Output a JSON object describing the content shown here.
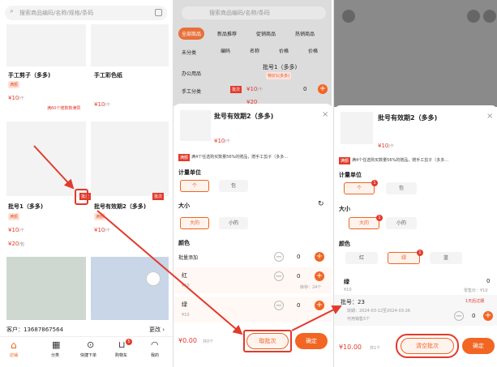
{
  "panel1": {
    "search_placeholder": "搜索商品编码/名称/规格/条码",
    "items": [
      {
        "name": "手工剪子（多多)",
        "tag": "满额",
        "price": "¥10",
        "unit": "/个",
        "promo": "满60个赠数数满赞"
      },
      {
        "name": "手工彩色纸",
        "price": "¥10",
        "unit": "/个"
      },
      {
        "name": "批号1（多多)",
        "tag": "满额",
        "price": "¥10",
        "unit": "/个",
        "price2": "¥20",
        "unit2": "/包",
        "pici": "批次"
      },
      {
        "name": "批号有效期2（多多)",
        "pici": "批次",
        "tag": "满额",
        "price": "¥10",
        "unit": "/个"
      }
    ],
    "customer": "客户：13687867564",
    "more": "更改 ›",
    "nav": [
      "店铺",
      "分类",
      "快捷下单",
      "购物车",
      "我的"
    ],
    "cart_count": "5"
  },
  "panel2": {
    "search_placeholder": "搜索商品编码/名称/条码",
    "cats": [
      "全部商品",
      "新品推荐",
      "促销商品",
      "热销商品"
    ],
    "cols": [
      "编码",
      "名称",
      "价格",
      "价格"
    ],
    "side": [
      "未分类",
      "办公用品",
      "手工分类"
    ],
    "list_name": "批号1（多多)",
    "list_tag": "特价1(多多)",
    "list_price": "¥10",
    "list_unit": "/个",
    "list_price2": "¥20",
    "list_zero": "0",
    "sheet": {
      "title": "批号有效期2（多多)",
      "price": "¥10",
      "unit": "/个",
      "promo_tag": "满额",
      "promo": "满4个任选购买数量56%的赠品，赠手工剪子（多多...",
      "label_unit": "计量单位",
      "units": [
        "个",
        "包"
      ],
      "label_size": "大小",
      "sizes": [
        "大的",
        "小的"
      ],
      "label_color": "颜色",
      "batch_add": "批量添加",
      "variants": [
        {
          "name": "红",
          "price": "¥10",
          "stock": "库存：24个",
          "qty": "0"
        },
        {
          "name": "绿",
          "price": "¥10",
          "qty": "0"
        }
      ],
      "batch_qty": "0",
      "total": "¥0.00",
      "count": "共0个",
      "btn_batch": "取批次",
      "btn_ok": "确定"
    }
  },
  "panel3": {
    "sheet": {
      "title": "批号有效期2（多多)",
      "price": "¥10",
      "unit": "/个",
      "promo_tag": "满额",
      "promo": "满4个任选购买数量56%的赠品，赠手工剪子（多多...",
      "label_unit": "计量单位",
      "units": [
        "个",
        "包"
      ],
      "label_size": "大小",
      "sizes": [
        "大的",
        "小的"
      ],
      "label_color": "颜色",
      "colors": [
        "红",
        "绿",
        "蓝"
      ],
      "variant_name": "绿",
      "variant_price": "¥10",
      "variant_qty": "0",
      "variant_stock": "零售价：¥10",
      "batch_no": "批号：23",
      "batch_expire": "1天后过期",
      "batch_date": "效期：2024-03-12至2024-03-26",
      "batch_stock": "可用销售5个",
      "batch_qty": "0",
      "total": "¥10.00",
      "count": "共1个",
      "btn_clear": "清空批次",
      "btn_ok": "确定"
    }
  }
}
